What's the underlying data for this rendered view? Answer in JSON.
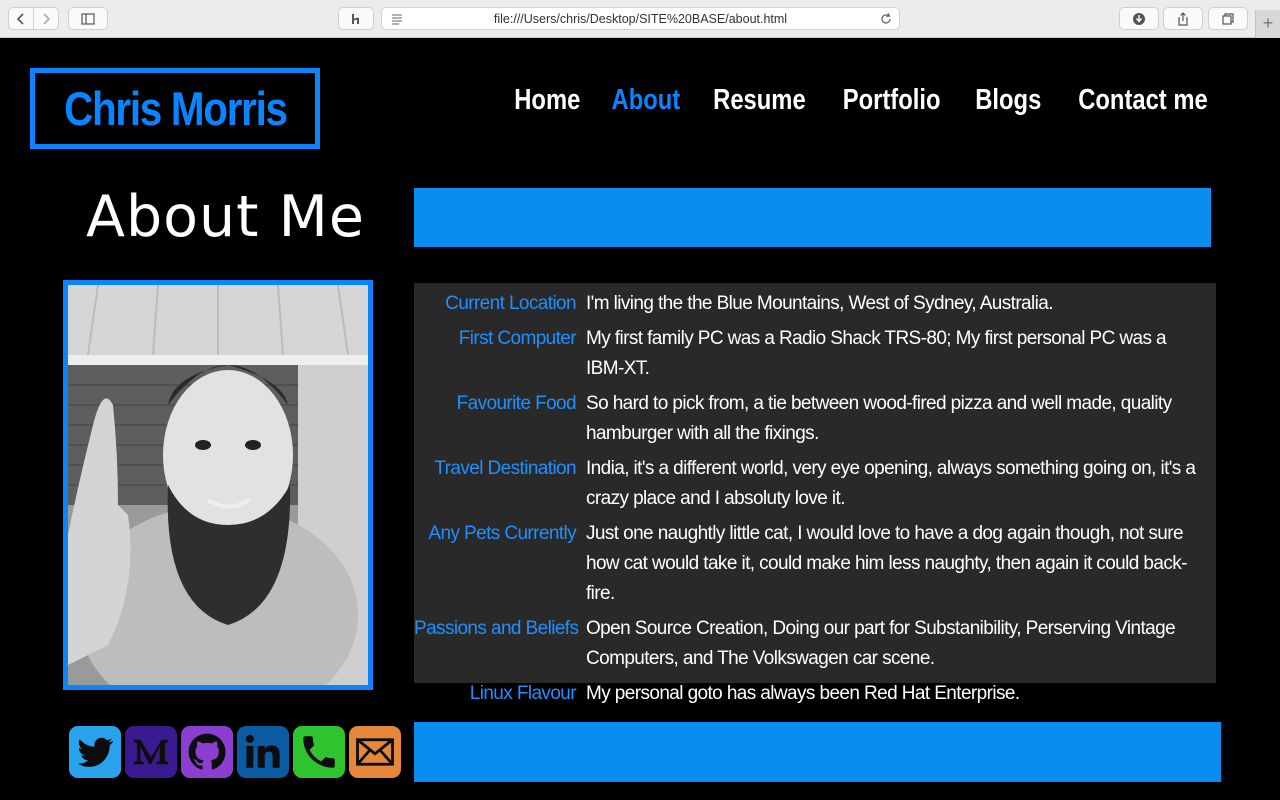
{
  "browser": {
    "url": "file:///Users/chris/Desktop/SITE%20BASE/about.html"
  },
  "site": {
    "logo": "Chris Morris",
    "nav": [
      "Home",
      "About",
      "Resume",
      "Portfolio",
      "Blogs",
      "Contact me"
    ],
    "active_nav": "About"
  },
  "about": {
    "title": "About Me",
    "rows": [
      {
        "label": "Current Location",
        "value": "I'm living the the Blue Mountains, West of Sydney, Australia."
      },
      {
        "label": "First Computer",
        "value": "My first family PC was a Radio Shack TRS-80; My first personal PC was a IBM-XT."
      },
      {
        "label": "Favourite Food",
        "value": "So hard to pick from, a tie between wood-fired pizza and well made, quality hamburger with all the fixings."
      },
      {
        "label": "Travel Destination",
        "value": "India, it's a different world, very eye opening, always something going on, it's a crazy place and I absoluty love it."
      },
      {
        "label": "Any Pets Currently",
        "value": "Just one naughtly little cat, I would love to have a dog again though, not sure how cat would take it, could make him less naughty, then again it could back-fire."
      },
      {
        "label": "Passions and Beliefs",
        "value": "Open Source Creation, Doing our part for Substanibility, Perserving Vintage Computers, and The Volkswagen car scene."
      },
      {
        "label": "Linux Flavour",
        "value": "My personal goto has always been Red Hat Enterprise."
      }
    ]
  },
  "social": [
    "twitter-icon",
    "medium-icon",
    "github-icon",
    "linkedin-icon",
    "phone-icon",
    "mail-icon"
  ],
  "colors": {
    "accent": "#0a84ff",
    "bar": "#0a8df0",
    "panel": "#292929"
  }
}
